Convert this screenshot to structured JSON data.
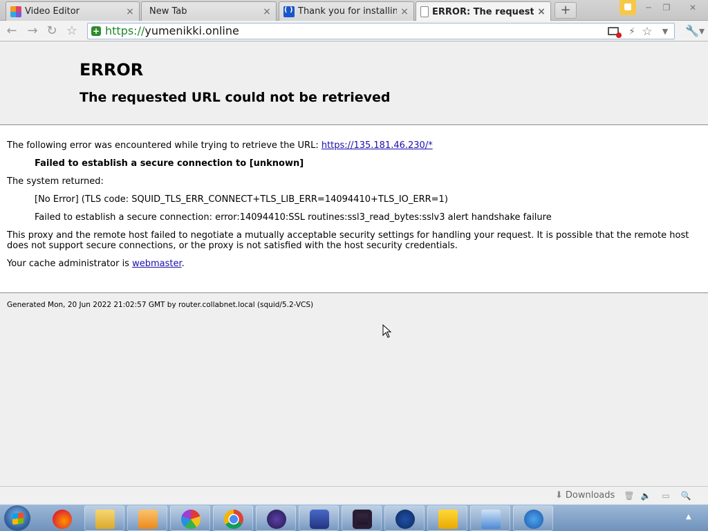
{
  "tabs": [
    {
      "title": "Video Editor",
      "favicon": "video-editor-icon",
      "active": false
    },
    {
      "title": "New Tab",
      "favicon": "blank-tab-icon",
      "active": false
    },
    {
      "title": "Thank you for installing Av",
      "favicon": "thank-you-site-icon",
      "active": false
    },
    {
      "title": "ERROR: The requested U",
      "favicon": "document-icon",
      "active": true
    }
  ],
  "tab_close_glyph": "×",
  "new_tab_glyph": "+",
  "toolbar": {
    "url_scheme": "https://",
    "url_host": "yumenikki.online"
  },
  "page": {
    "heading": "ERROR",
    "subheading": "The requested URL could not be retrieved",
    "line1_prefix": "The following error was encountered while trying to retrieve the URL:",
    "line1_link": "https://135.181.46.230/*",
    "line2": "Failed to establish a secure connection to [unknown]",
    "line3": "The system returned:",
    "line4": "[No Error] (TLS code: SQUID_TLS_ERR_CONNECT+TLS_LIB_ERR=14094410+TLS_IO_ERR=1)",
    "line5": "Failed to establish a secure connection: error:14094410:SSL routines:ssl3_read_bytes:sslv3 alert handshake failure",
    "line6": "This proxy and the remote host failed to negotiate a mutually acceptable security settings for handling your request. It is possible that the remote host does not support secure connections, or the proxy is not satisfied with the host security credentials.",
    "line7_prefix": "Your cache administrator is",
    "line7_link": "webmaster",
    "line7_suffix": ".",
    "footer": "Generated Mon, 20 Jun 2022 21:02:57 GMT by router.collabnet.local (squid/5.2-VCS)"
  },
  "downloads_bar": {
    "label": "Downloads"
  },
  "taskbar": {
    "apps": [
      "firefox-icon",
      "file-explorer-icon",
      "media-player-icon",
      "photos-app-icon",
      "chrome-icon",
      "game-app-icon",
      "screen-tool-icon",
      "video-recorder-icon",
      "ccleaner-icon",
      "sab-app-icon",
      "remote-desktop-icon",
      "pen-app-icon"
    ]
  },
  "colors": {
    "secure_scheme": "#22862e",
    "link": "#1a0dab",
    "page_bg": "#efefef"
  }
}
